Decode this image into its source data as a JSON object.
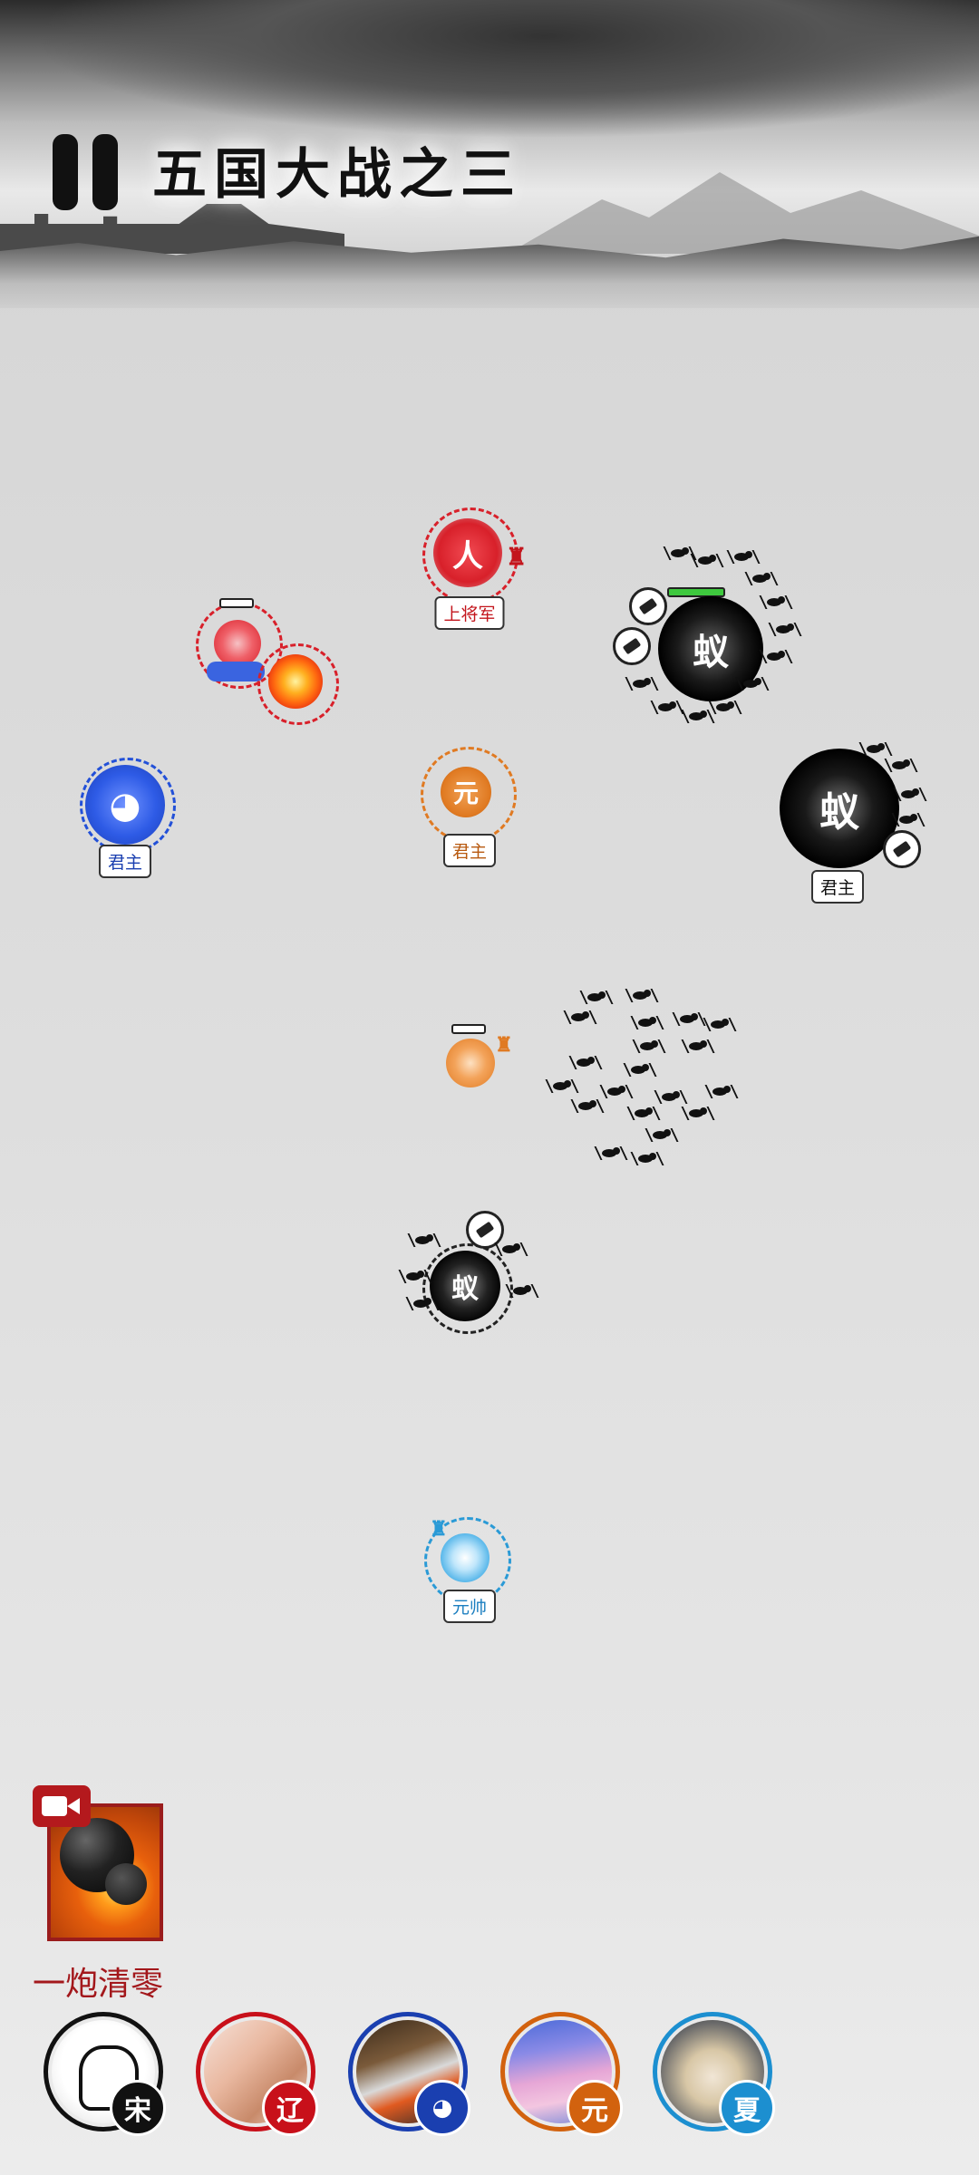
{
  "header": {
    "title": "五国大战之三"
  },
  "units": {
    "song_general": {
      "glyph": "人",
      "label": "上将军"
    },
    "yuan_lord": {
      "glyph": "元",
      "label": "君主"
    },
    "liao_lord": {
      "label": "君主"
    },
    "ant_lord": {
      "glyph": "蚁",
      "label": "君主"
    },
    "ant_main": {
      "glyph": "蚁"
    },
    "ant_small": {
      "glyph": "蚁"
    },
    "xia_marshal": {
      "label": "元帅"
    }
  },
  "skill": {
    "name": "一炮清零",
    "icon": "cannonball-icon",
    "video_icon": "video-camera-icon"
  },
  "factions": [
    {
      "name": "宋",
      "color": "#111111"
    },
    {
      "name": "辽",
      "color": "#c8101a"
    },
    {
      "name": "",
      "icon": "dog-icon",
      "color": "#1a3fb0"
    },
    {
      "name": "元",
      "color": "#d2620e"
    },
    {
      "name": "夏",
      "color": "#1c8fd0"
    }
  ],
  "colors": {
    "song": "#d8202a",
    "liao": "#2250d8",
    "yuan": "#e07a22",
    "xia": "#2a9ad6",
    "ant": "#111111"
  }
}
